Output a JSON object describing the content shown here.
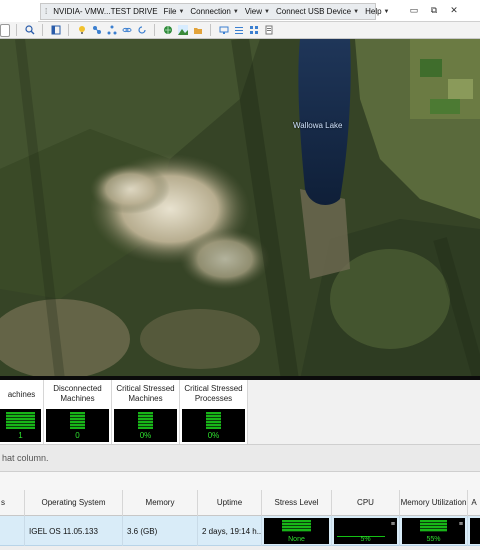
{
  "window": {
    "title": "NVIDIA- VMW...TEST DRIVE",
    "menus": [
      {
        "label": "File"
      },
      {
        "label": "Connection"
      },
      {
        "label": "View"
      },
      {
        "label": "Connect USB Device"
      },
      {
        "label": "Help"
      }
    ]
  },
  "map": {
    "lake_label": "Wallowa Lake"
  },
  "summary": {
    "cards": [
      {
        "label": "achines",
        "value": "1"
      },
      {
        "label": "Disconnected Machines",
        "value": "0"
      },
      {
        "label": "Critical Stressed Machines",
        "value": "0%"
      },
      {
        "label": "Critical Stressed Processes",
        "value": "0%"
      }
    ]
  },
  "grid": {
    "group_hint": "hat column.",
    "columns": [
      "s",
      "Operating System",
      "Memory",
      "Uptime",
      "Stress Level",
      "CPU",
      "Memory Utilization",
      "A"
    ],
    "row": {
      "os": "IGEL OS 11.05.133",
      "memory": "3.6 (GB)",
      "uptime": "2 days, 19:14 h...",
      "stress": "None",
      "cpu": "5%",
      "memory_util": "55%"
    }
  }
}
